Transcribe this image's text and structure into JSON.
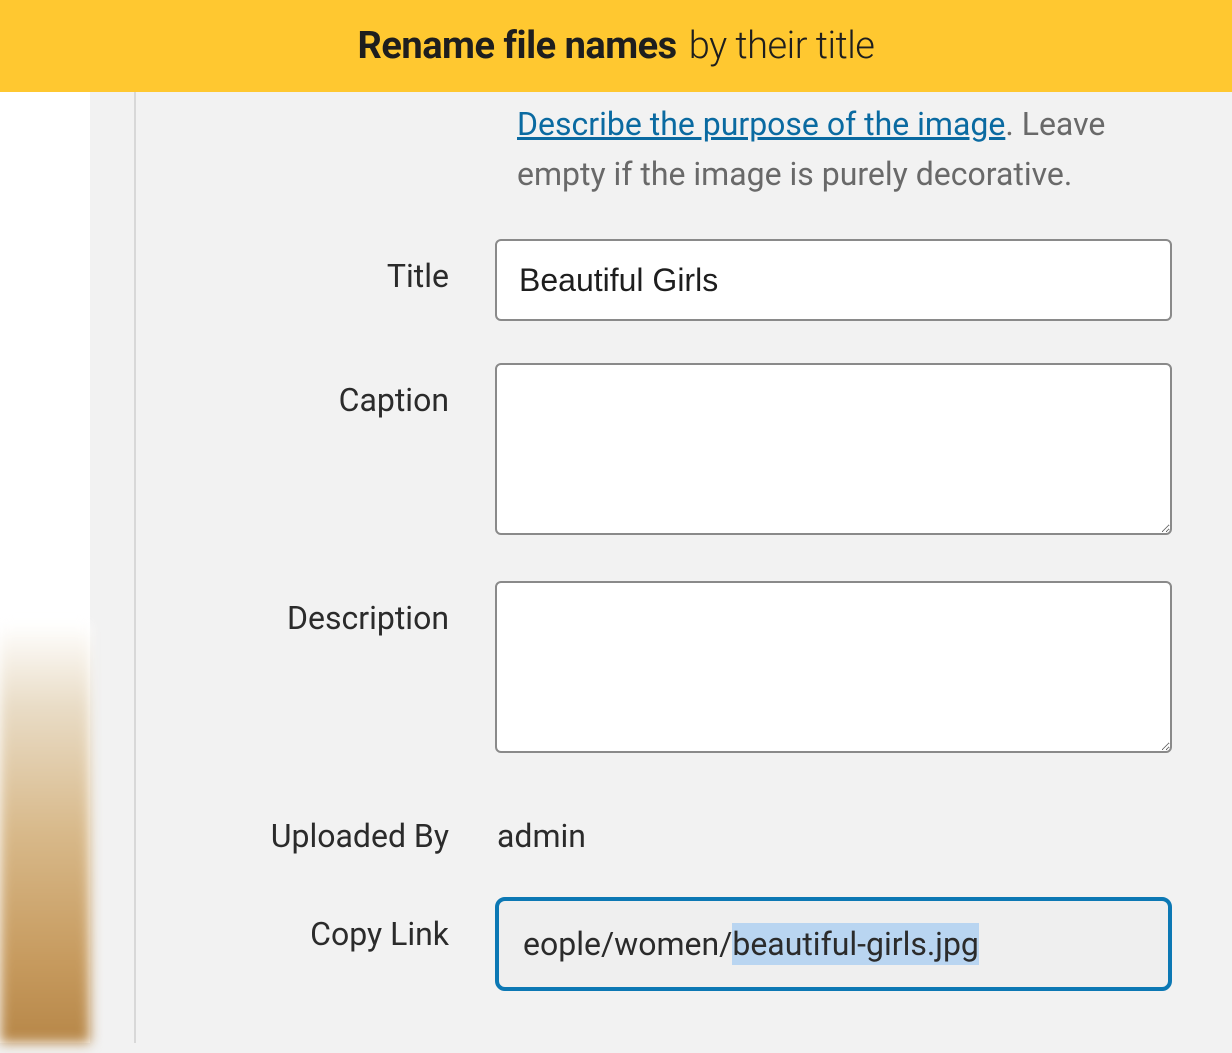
{
  "banner": {
    "bold": "Rename file names",
    "light": "by their title"
  },
  "helper": {
    "link_text": "Describe the purpose of the image",
    "suffix": ". Leave empty if the image is purely decorative."
  },
  "fields": {
    "title": {
      "label": "Title",
      "value": "Beautiful Girls"
    },
    "caption": {
      "label": "Caption",
      "value": ""
    },
    "description": {
      "label": "Description",
      "value": ""
    },
    "uploaded_by": {
      "label": "Uploaded By",
      "value": "admin"
    },
    "copy_link": {
      "label": "Copy Link",
      "visible_prefix": "eople/women/",
      "highlighted": "beautiful-girls.jpg"
    }
  }
}
